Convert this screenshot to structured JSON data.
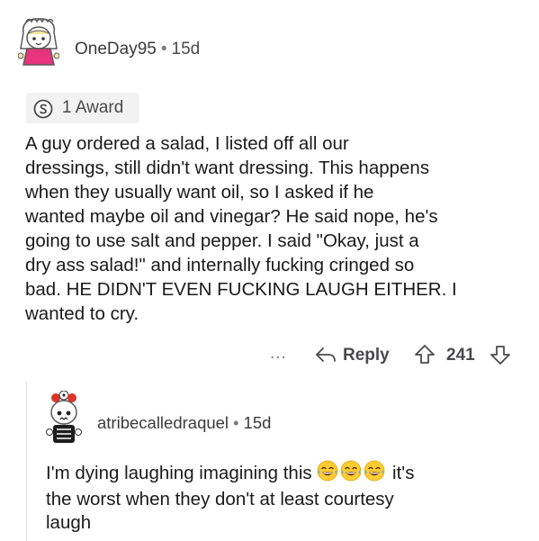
{
  "comment": {
    "username": "OneDay95",
    "separator": "•",
    "age": "15d",
    "award_label": "1 Award",
    "body_lines": [
      "A guy ordered a salad, I listed off all our",
      "dressings, still didn't want dressing. This happens",
      "when they usually want oil, so I asked if he",
      "wanted maybe oil and vinegar? He said nope, he's",
      "going to use salt and pepper. I said \"Okay, just a",
      "dry ass salad!\" and internally fucking cringed so",
      "bad. HE DIDN'T EVEN FUCKING LAUGH EITHER. I",
      "wanted to cry."
    ],
    "more_label": "...",
    "reply_label": "Reply",
    "score": "241"
  },
  "reply": {
    "username": "atribecalledraquel",
    "separator": "•",
    "age": "15d",
    "line1_before": "I'm dying laughing imagining this",
    "line1_after": "it's",
    "line2": "the worst when they don't at least courtesy",
    "line3": "laugh",
    "emoji_name": "face-with-tears-of-joy-emoji"
  },
  "colors": {
    "text": "#1a1a1b",
    "meta": "#4a4a4c",
    "award_bg": "#f2f2f2",
    "thread_line": "#dadada"
  }
}
